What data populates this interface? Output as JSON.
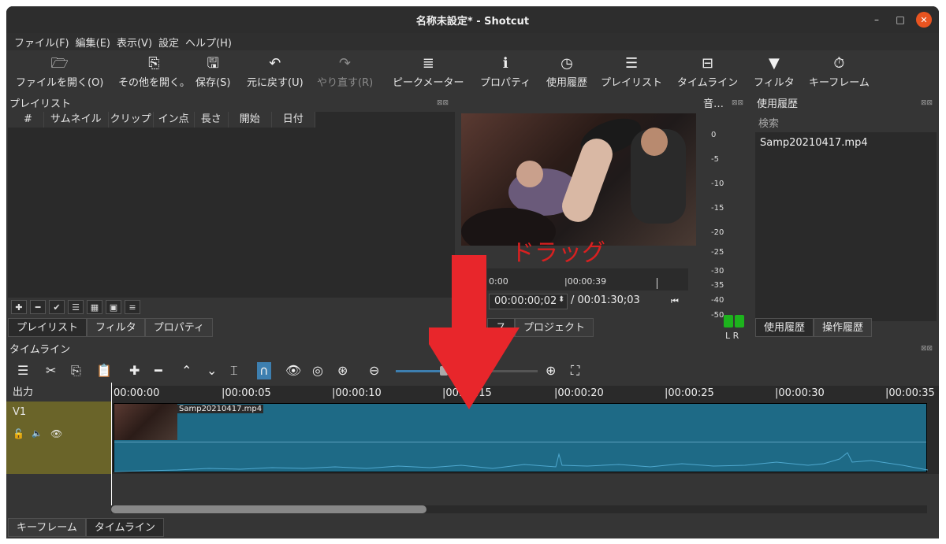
{
  "window": {
    "title": "名称未設定* - Shotcut",
    "controls": [
      "–",
      "□",
      "✕"
    ]
  },
  "menu": [
    "ファイル(F)",
    "編集(E)",
    "表示(V)",
    "設定",
    "ヘルプ(H)"
  ],
  "toolbar": [
    {
      "label": "ファイルを開く(O)",
      "icon": "folder-icon",
      "glyph": "🗁",
      "enabled": true
    },
    {
      "label": "その他を開く。",
      "icon": "open-other-icon",
      "glyph": "⎘",
      "enabled": true
    },
    {
      "label": "保存(S)",
      "icon": "save-icon",
      "glyph": "🖫",
      "enabled": true
    },
    {
      "label": "元に戻す(U)",
      "icon": "undo-icon",
      "glyph": "↶",
      "enabled": true
    },
    {
      "label": "やり直す(R)",
      "icon": "redo-icon",
      "glyph": "↷",
      "enabled": false
    },
    {
      "label": "ピークメーター",
      "icon": "peak-meter-icon",
      "glyph": "≣",
      "enabled": true
    },
    {
      "label": "プロパティ",
      "icon": "info-icon",
      "glyph": "ℹ",
      "enabled": true
    },
    {
      "label": "使用履歴",
      "icon": "clock-icon",
      "glyph": "◷",
      "enabled": true
    },
    {
      "label": "プレイリスト",
      "icon": "list-icon",
      "glyph": "☰",
      "enabled": true
    },
    {
      "label": "タイムライン",
      "icon": "timeline-icon",
      "glyph": "⊟",
      "enabled": true
    },
    {
      "label": "フィルタ",
      "icon": "filter-icon",
      "glyph": "▼",
      "enabled": true
    },
    {
      "label": "キーフレーム",
      "icon": "stopwatch-icon",
      "glyph": "⏱",
      "enabled": true
    }
  ],
  "playlist": {
    "title": "プレイリスト",
    "columns": [
      "#",
      "サムネイル",
      "クリップ",
      "イン点",
      "長さ",
      "開始",
      "日付"
    ],
    "tabs": [
      "プレイリスト",
      "フィルタ",
      "プロパティ"
    ]
  },
  "player": {
    "ruler_labels": [
      "0:00",
      "|00:00:39"
    ],
    "current_time": "00:00:00;02",
    "total_time": "/ 00:01:30;03",
    "tabs": [
      "ス",
      "プロジェクト"
    ]
  },
  "meter": {
    "title": "音…",
    "labels": [
      "0",
      "-5",
      "-10",
      "-15",
      "-20",
      "-25",
      "-30",
      "-35",
      "-40",
      "-50"
    ],
    "channels": "L R"
  },
  "recent": {
    "title": "使用履歴",
    "search_placeholder": "検索",
    "items": [
      "Samp20210417.mp4"
    ],
    "tabs": [
      "使用履歴",
      "操作履歴"
    ]
  },
  "timeline": {
    "title": "タイムライン",
    "output_label": "出力",
    "track_name": "V1",
    "ruler": [
      "00:00:00",
      "|00:00:05",
      "|00:00:10",
      "|00:00:15",
      "|00:00:20",
      "|00:00:25",
      "|00:00:30",
      "|00:00:35"
    ],
    "clip_name": "Samp20210417.mp4"
  },
  "bottom_tabs": [
    "キーフレーム",
    "タイムライン"
  ],
  "annotation": {
    "text": "ドラッグ",
    "color": "#d92020"
  }
}
